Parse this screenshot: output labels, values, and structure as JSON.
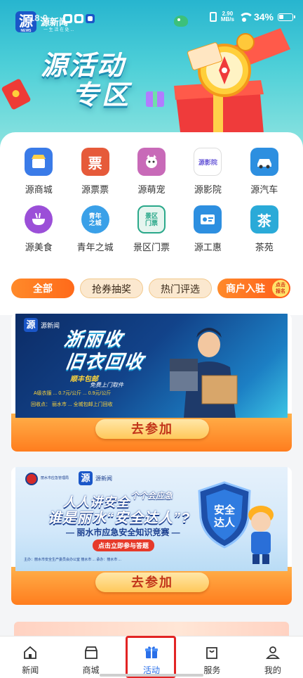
{
  "status_bar": {
    "time": "18:0",
    "net_speed_value": "2.90",
    "net_speed_unit": "MB/s",
    "battery": "34%"
  },
  "app": {
    "logo_char": "源",
    "logo_sub": "NEWS",
    "brand": "源新闻",
    "brand_sub": "一 生 活 在 处 ..."
  },
  "hero": {
    "title_line1": "源活动",
    "title_line2": "专区"
  },
  "services": [
    {
      "label": "源商城",
      "icon": "shop-icon",
      "color": "#3a7be8"
    },
    {
      "label": "源票票",
      "icon": "ticket-icon",
      "color": "#e65a3a"
    },
    {
      "label": "源萌宠",
      "icon": "pet-icon",
      "color": "#c86ab8"
    },
    {
      "label": "源影院",
      "icon": "cinema-icon",
      "color": "#6a5ad8"
    },
    {
      "label": "源汽车",
      "icon": "car-icon",
      "color": "#2d8fe0"
    },
    {
      "label": "源美食",
      "icon": "food-icon",
      "color": "#9b4fd8"
    },
    {
      "label": "青年之城",
      "icon": "youth-city-icon",
      "color": "#3aa0e8"
    },
    {
      "label": "景区门票",
      "icon": "scenic-ticket-icon",
      "color": "#2aa88a"
    },
    {
      "label": "源工惠",
      "icon": "worker-card-icon",
      "color": "#2d8fe0"
    },
    {
      "label": "茶苑",
      "icon": "tea-icon",
      "color": "#2aaad8"
    }
  ],
  "service_glyphs": [
    "",
    "票",
    "",
    "",
    "",
    "",
    "",
    "",
    "",
    "茶"
  ],
  "youth_icon_text": "青年\n之城",
  "scenic_icon_text": "景区\n门票",
  "cinema_icon_text": "源影院",
  "filters": {
    "all": "全部",
    "coupon": "抢券抽奖",
    "hot": "热门评选",
    "merchant": "商户入驻",
    "merchant_badge": "点击\n报名"
  },
  "activities": [
    {
      "brand": "源新闻",
      "title1": "浙丽收",
      "title2": "旧衣回收",
      "tag": "顺丰包邮",
      "tag2": "免费上门取件",
      "price": "A级衣服 ... 0.7元/公斤  ... 0.9元/公斤",
      "note": "回收点：  丽水市 ... 全城包邮上门回收",
      "join": "去参加"
    },
    {
      "org": "丽水市应急管理局",
      "brand": "源新闻",
      "line1": "人人讲安全",
      "line1b": "个个会应急",
      "line2": "谁是丽水“安全达人”?",
      "line3": "— 丽水市应急安全知识竞赛 —",
      "cta": "点击立即参与答题",
      "shield_text": "安全\n达人",
      "foot": "主办：丽水市安全生产委员会办公室  丽水市 ...  承办：丽水市 ...",
      "join": "去参加"
    }
  ],
  "nav": [
    {
      "label": "新闻",
      "icon": "home-icon",
      "active": false
    },
    {
      "label": "商城",
      "icon": "store-icon",
      "active": false
    },
    {
      "label": "活动",
      "icon": "gift-icon",
      "active": true
    },
    {
      "label": "服务",
      "icon": "service-bag-icon",
      "active": false
    },
    {
      "label": "我的",
      "icon": "profile-icon",
      "active": false
    }
  ],
  "colors": {
    "accent": "#2a6fe8",
    "orange": "#ff7d1e",
    "header_teal": "#27b5cf",
    "highlight": "#e22424"
  }
}
